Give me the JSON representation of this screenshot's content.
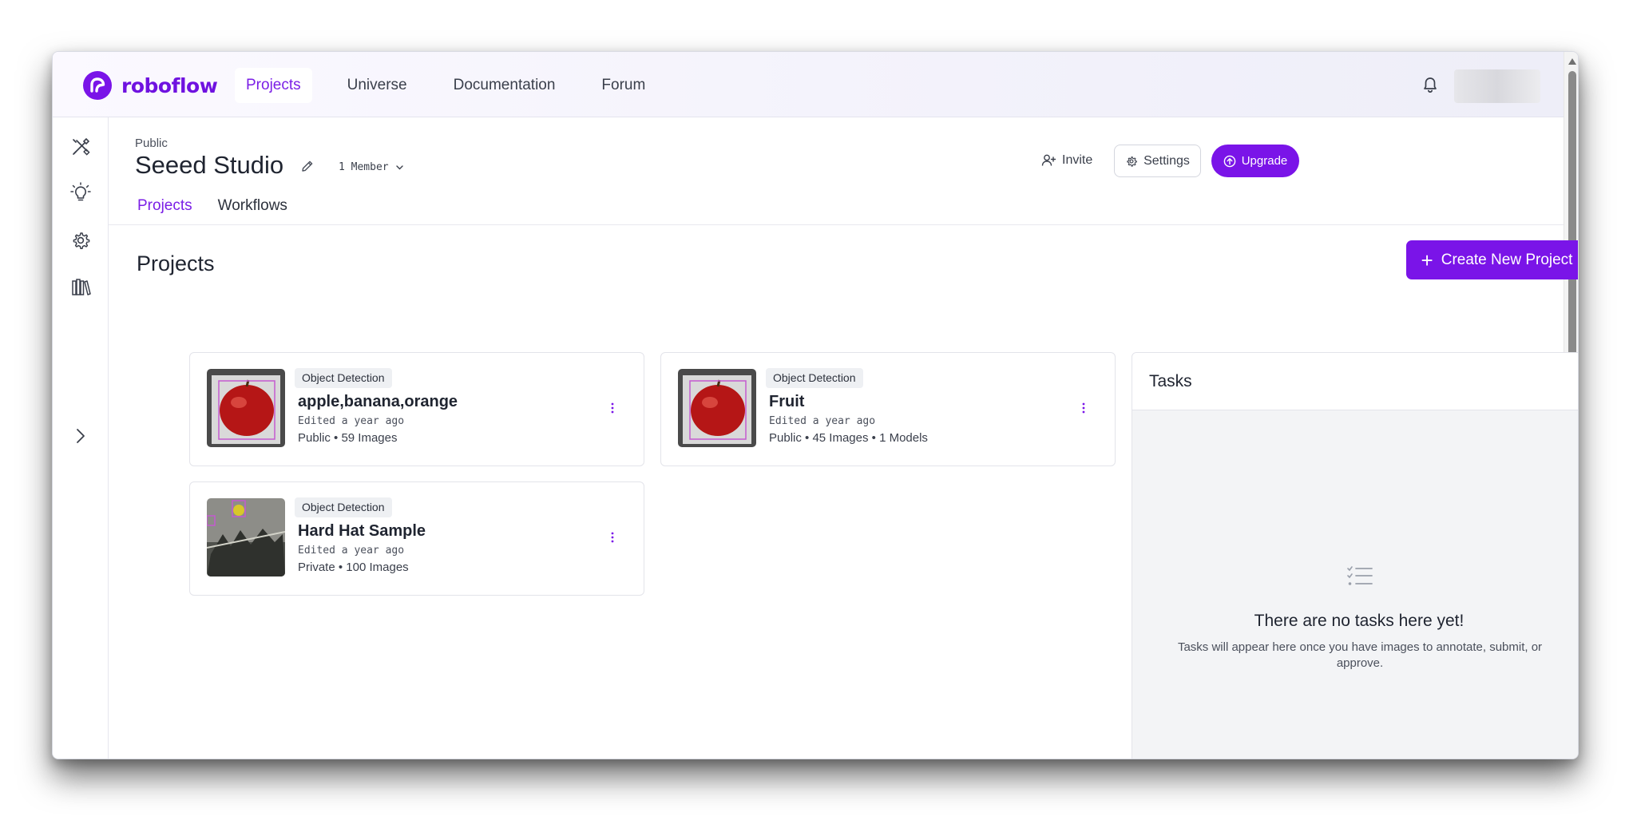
{
  "brand": {
    "name": "roboflow",
    "color": "#7a14e8"
  },
  "topnav": {
    "items": [
      {
        "label": "Projects",
        "active": true
      },
      {
        "label": "Universe",
        "active": false
      },
      {
        "label": "Documentation",
        "active": false
      },
      {
        "label": "Forum",
        "active": false
      }
    ],
    "icons": [
      "bell-icon"
    ]
  },
  "sidebar": {
    "icons": [
      "tools-icon",
      "lightbulb-icon",
      "gear-icon",
      "library-icon",
      "chevron-right-icon"
    ]
  },
  "workspace": {
    "visibility": "Public",
    "name": "Seeed Studio",
    "members": "1 Member",
    "actions": {
      "invite": "Invite",
      "settings": "Settings",
      "upgrade": "Upgrade"
    }
  },
  "tabs": [
    {
      "label": "Projects",
      "active": true
    },
    {
      "label": "Workflows",
      "active": false
    }
  ],
  "projects_section": {
    "title": "Projects",
    "create_label": "Create New Project",
    "cards": [
      {
        "type": "Object Detection",
        "name": "apple,banana,orange",
        "edited": "Edited a year ago",
        "meta": "Public • 59 Images"
      },
      {
        "type": "Object Detection",
        "name": "Fruit",
        "edited": "Edited a year ago",
        "meta": "Public • 45 Images • 1 Models"
      },
      {
        "type": "Object Detection",
        "name": "Hard Hat Sample",
        "edited": "Edited a year ago",
        "meta": "Private • 100 Images"
      }
    ]
  },
  "tasks": {
    "title": "Tasks",
    "empty_title": "There are no tasks here yet!",
    "empty_desc": "Tasks will appear here once you have images to annotate, submit, or approve."
  }
}
